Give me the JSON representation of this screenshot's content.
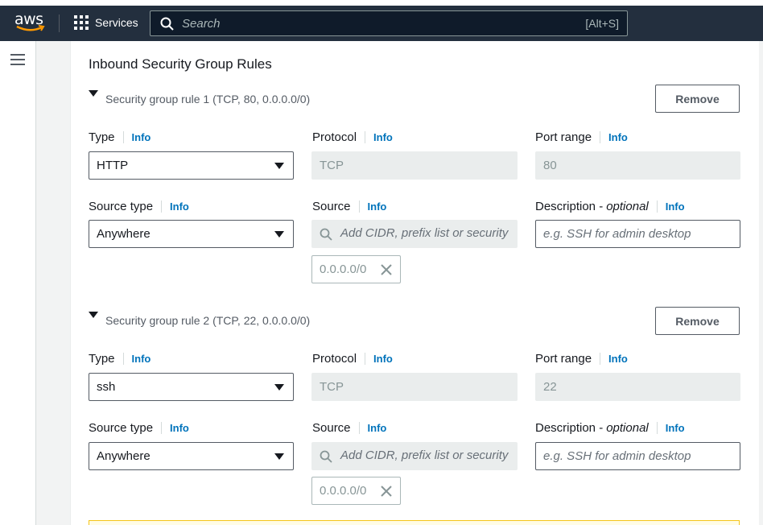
{
  "topnav": {
    "logo": "aws",
    "services_label": "Services",
    "search_placeholder": "Search",
    "search_shortcut": "[Alt+S]"
  },
  "section_title": "Inbound Security Group Rules",
  "rules": [
    {
      "title": "Security group rule 1 (TCP, 80, 0.0.0.0/0)",
      "remove_label": "Remove",
      "type_label": "Type",
      "type_value": "HTTP",
      "protocol_label": "Protocol",
      "protocol_value": "TCP",
      "port_label": "Port range",
      "port_value": "80",
      "source_type_label": "Source type",
      "source_type_value": "Anywhere",
      "source_label": "Source",
      "source_placeholder": "Add CIDR, prefix list or security",
      "source_token": "0.0.0.0/0",
      "desc_label": "Description -",
      "desc_optional": "optional",
      "desc_placeholder": "e.g. SSH for admin desktop"
    },
    {
      "title": "Security group rule 2 (TCP, 22, 0.0.0.0/0)",
      "remove_label": "Remove",
      "type_label": "Type",
      "type_value": "ssh",
      "protocol_label": "Protocol",
      "protocol_value": "TCP",
      "port_label": "Port range",
      "port_value": "22",
      "source_type_label": "Source type",
      "source_type_value": "Anywhere",
      "source_label": "Source",
      "source_placeholder": "Add CIDR, prefix list or security",
      "source_token": "0.0.0.0/0",
      "desc_label": "Description -",
      "desc_optional": "optional",
      "desc_placeholder": "e.g. SSH for admin desktop"
    }
  ],
  "info_label": "Info",
  "colors": {
    "nav_bg": "#232f3e",
    "link": "#0073bb",
    "smile": "#ff9900"
  }
}
